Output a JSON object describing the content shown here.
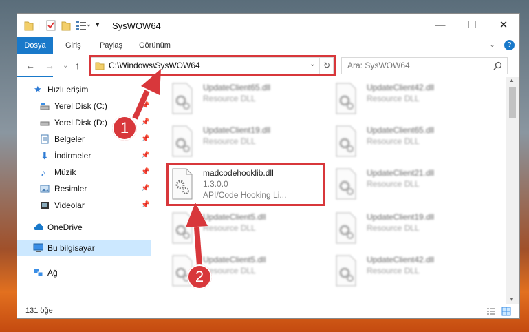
{
  "window": {
    "title": "SysWOW64"
  },
  "ribbon": {
    "tabs": [
      "Dosya",
      "Giriş",
      "Paylaş",
      "Görünüm"
    ]
  },
  "nav": {
    "address": "C:\\Windows\\SysWOW64",
    "search_placeholder": "Ara: SysWOW64"
  },
  "sidebar": {
    "quick_access": "Hızlı erişim",
    "items": [
      "Yerel Disk (C:)",
      "Yerel Disk (D:)",
      "Belgeler",
      "İndirmeler",
      "Müzik",
      "Resimler",
      "Videolar"
    ],
    "onedrive": "OneDrive",
    "this_pc": "Bu bilgisayar",
    "network": "Ağ"
  },
  "files": [
    {
      "name": "UpdateClient65.dll",
      "line1": "Resource DLL"
    },
    {
      "name": "UpdateClient42.dll",
      "line1": "Resource DLL"
    },
    {
      "name": "UpdateClient19.dll",
      "line1": "Resource DLL"
    },
    {
      "name": "UpdateClient65.dll",
      "line1": "Resource DLL"
    },
    {
      "name": "madcodehooklib.dll",
      "line1": "1.3.0.0",
      "line2": "API/Code Hooking Li..."
    },
    {
      "name": "UpdateClient21.dll",
      "line1": "Resource DLL"
    },
    {
      "name": "UpdateClient5.dll",
      "line1": "Resource DLL"
    },
    {
      "name": "UpdateClient19.dll",
      "line1": "Resource DLL"
    },
    {
      "name": "UpdateClient5.dll",
      "line1": "Resource DLL"
    },
    {
      "name": "UpdateClient42.dll",
      "line1": "Resource DLL"
    }
  ],
  "status": {
    "count": "131 öğe"
  },
  "callouts": [
    "1",
    "2"
  ],
  "colors": {
    "accent": "#1979ca",
    "highlight": "#d8373b",
    "selection": "#cce8ff"
  }
}
